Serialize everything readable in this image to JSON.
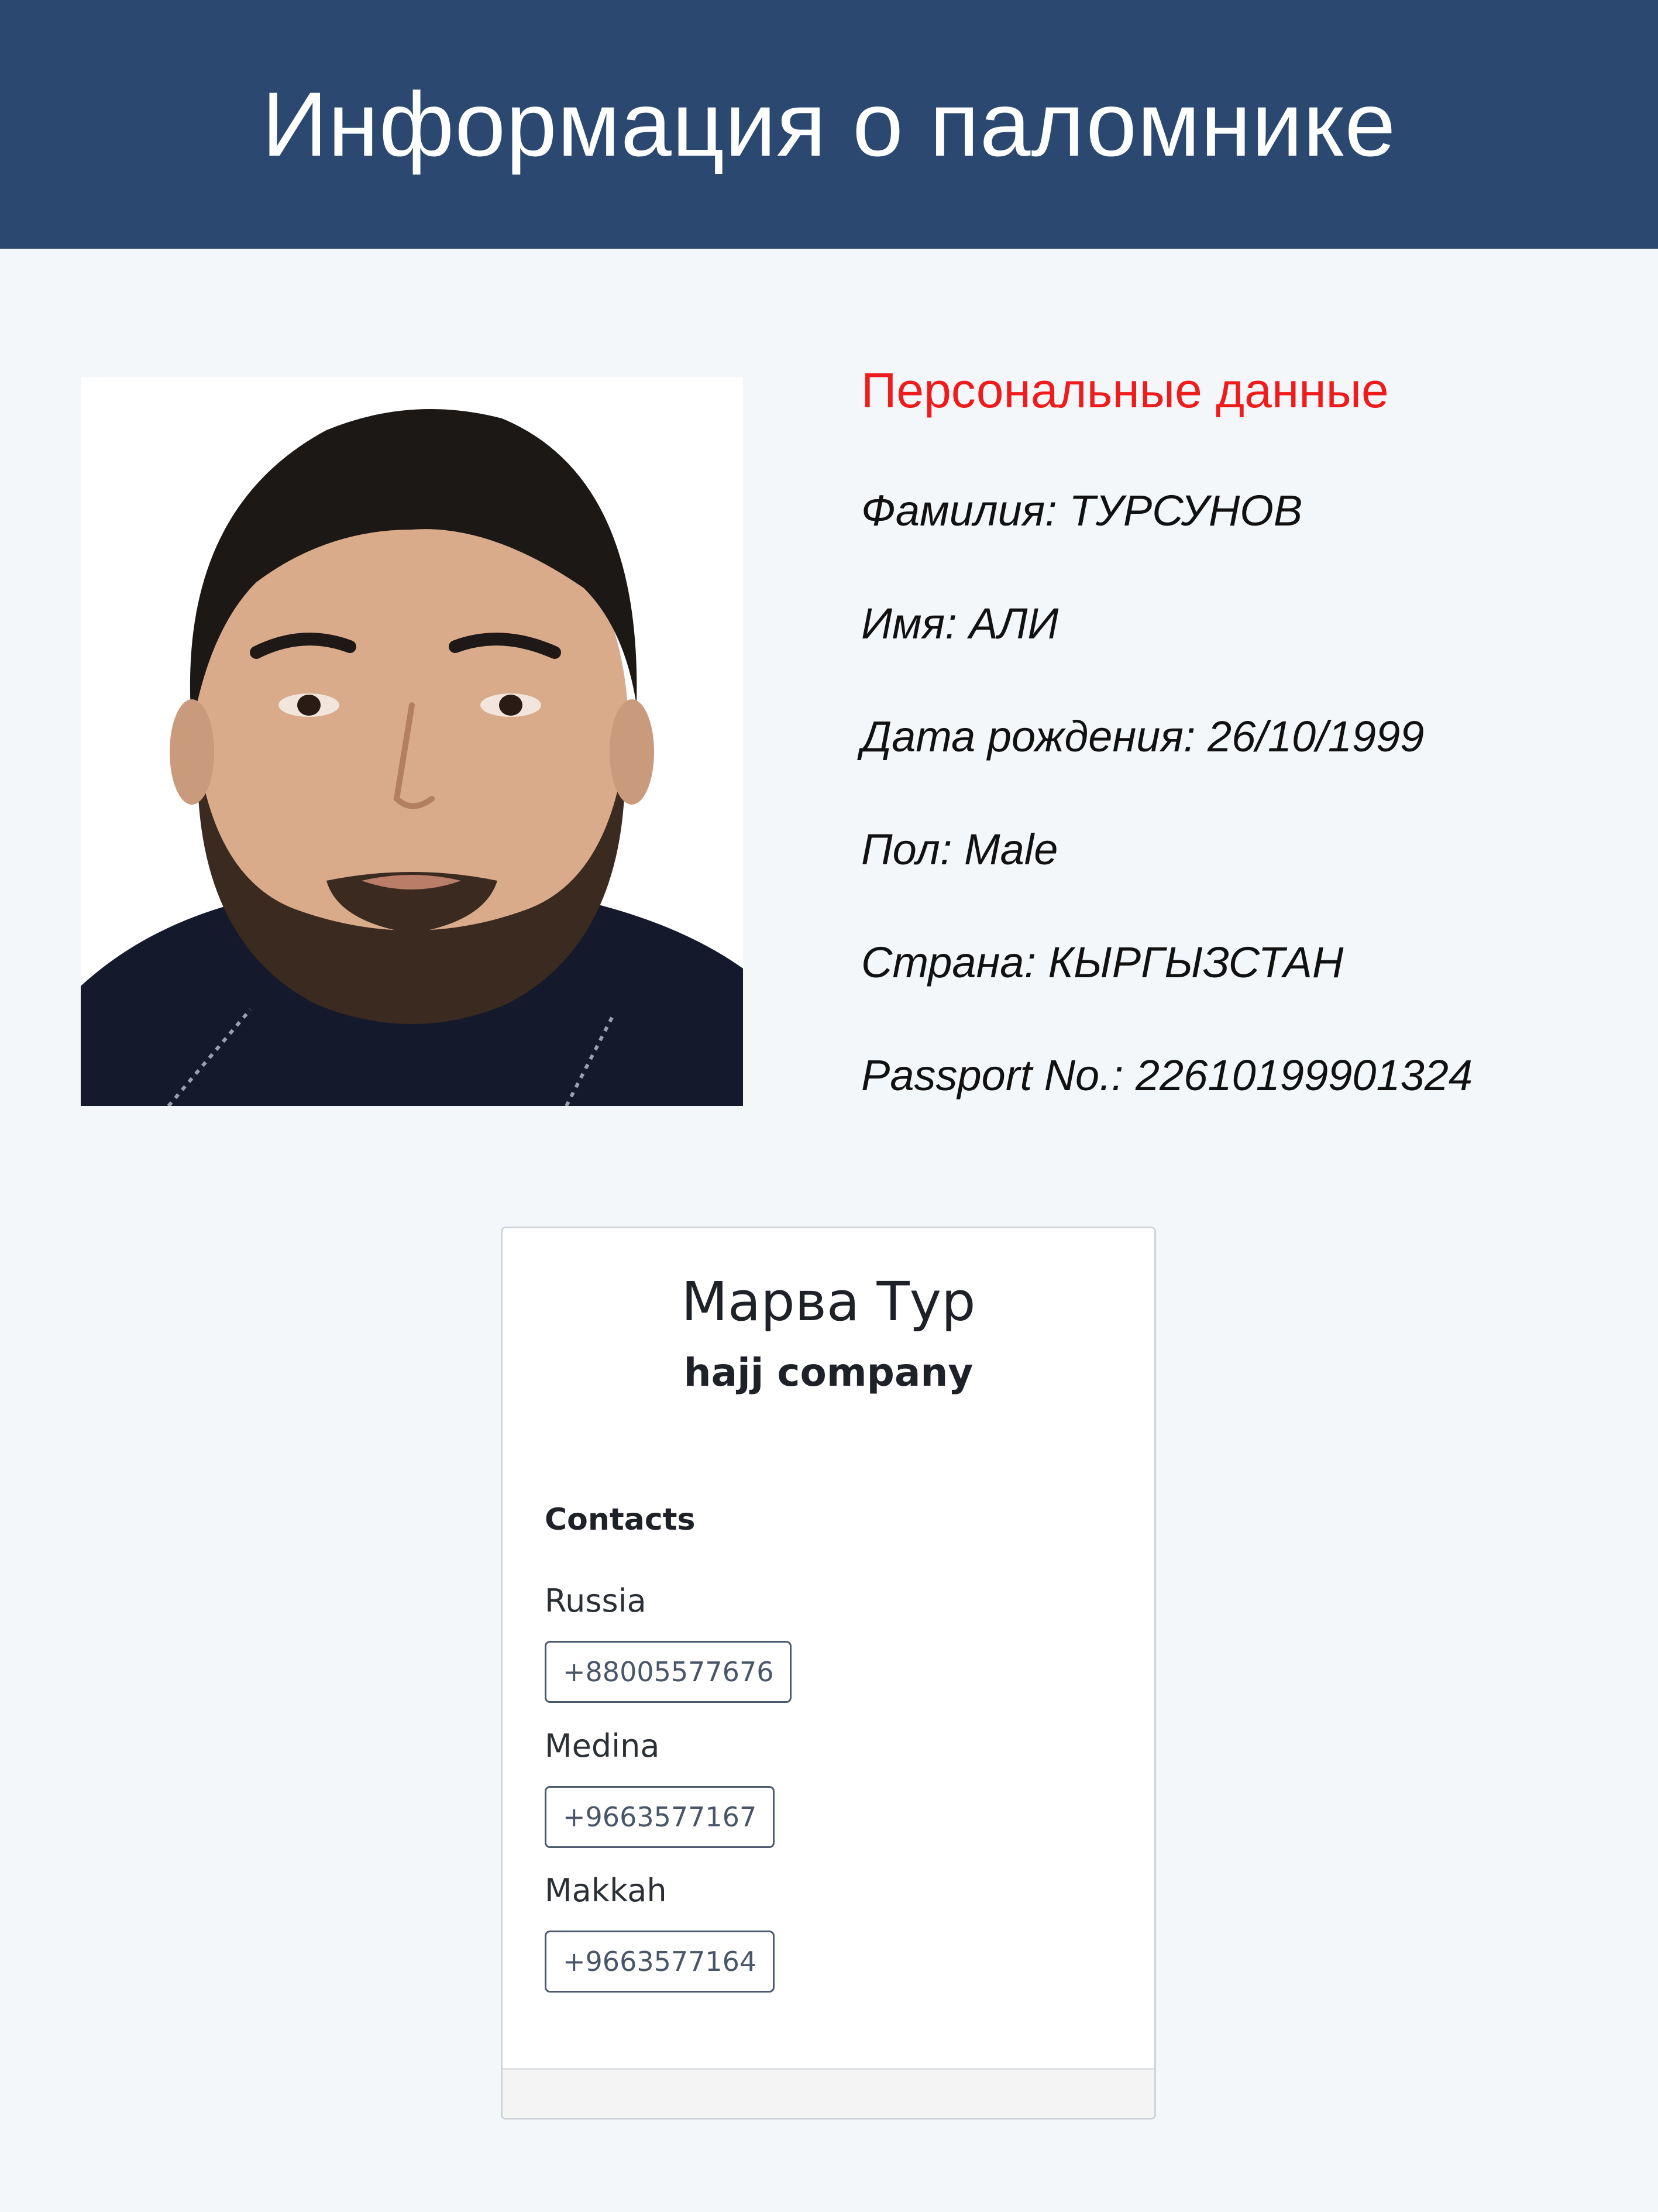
{
  "header": {
    "title": "Информация о паломнике"
  },
  "photo": {
    "alt": "Фото паломника"
  },
  "personal": {
    "section_title": "Персональные данные",
    "fields": [
      "Фамилия: ТУРСУНОВ",
      "Имя: АЛИ",
      "Дата рождения: 26/10/1999",
      "Пол: Male",
      "Страна: КЫРГЫЗСТАН",
      "Passport No.: 22610199901324"
    ]
  },
  "company_card": {
    "name": "Марва Тур",
    "type": "hajj company",
    "contacts_heading": "Contacts",
    "contacts": [
      {
        "label": "Russia",
        "phone": "+88005577676"
      },
      {
        "label": "Medina",
        "phone": "+9663577167"
      },
      {
        "label": "Makkah",
        "phone": "+9663577164"
      }
    ]
  },
  "colors": {
    "header_bg": "#2b4870",
    "page_bg": "#f4f7fa",
    "section_title": "#ee1c1c",
    "button_border": "#4d5a6e"
  }
}
